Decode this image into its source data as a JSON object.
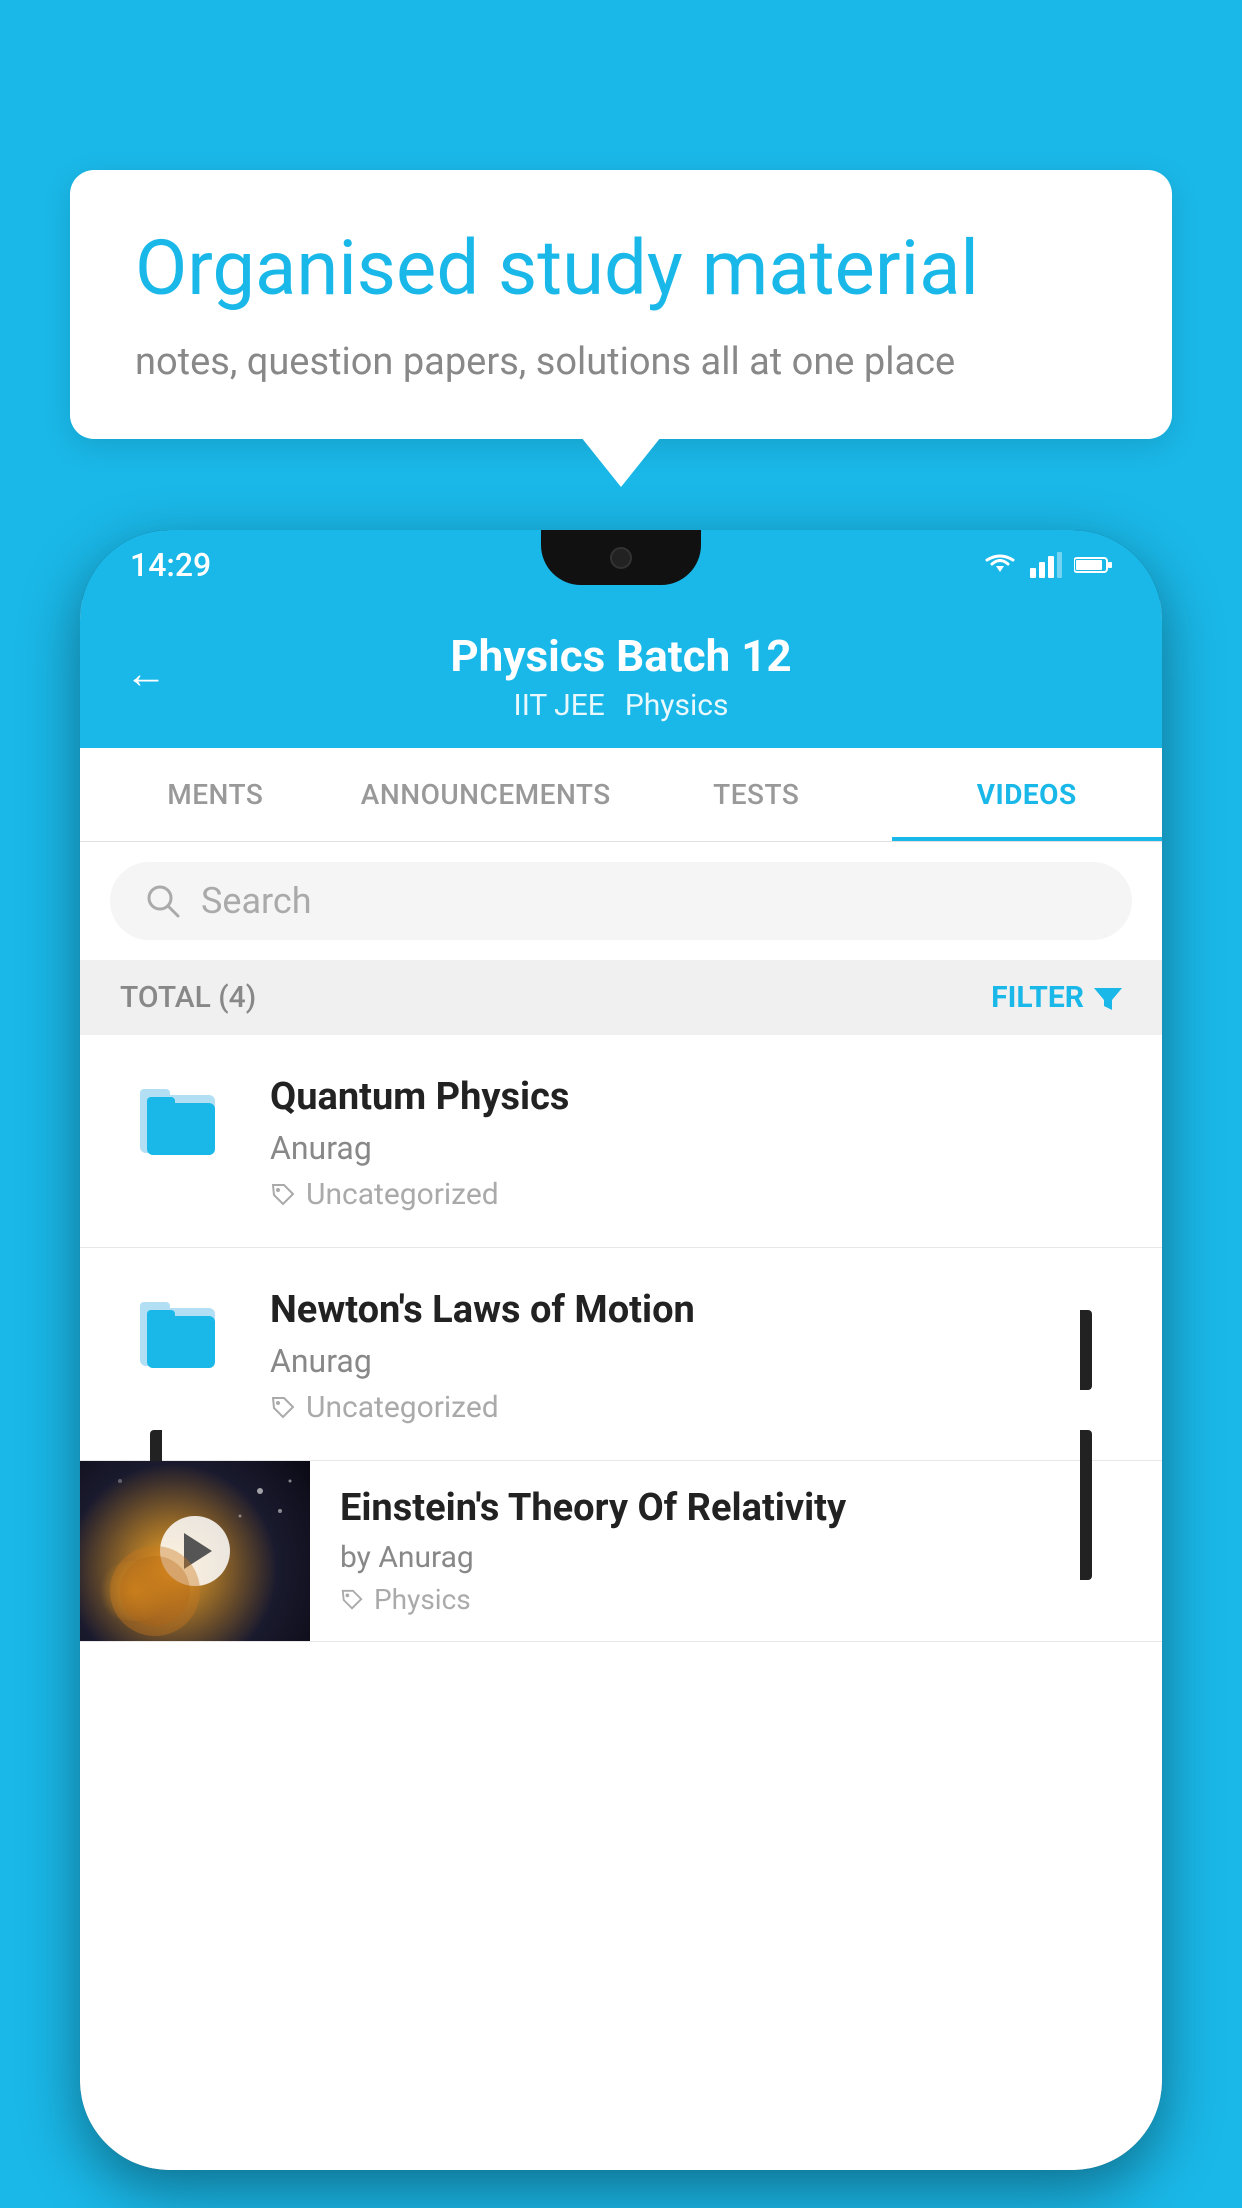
{
  "background_color": "#1ab8e8",
  "bubble": {
    "title": "Organised study material",
    "subtitle": "notes, question papers, solutions all at one place"
  },
  "phone": {
    "status_bar": {
      "time": "14:29",
      "icons": [
        "wifi",
        "signal",
        "battery"
      ]
    },
    "header": {
      "back_label": "←",
      "title": "Physics Batch 12",
      "tags": [
        "IIT JEE",
        "Physics"
      ]
    },
    "tabs": [
      {
        "label": "MENTS",
        "active": false
      },
      {
        "label": "ANNOUNCEMENTS",
        "active": false
      },
      {
        "label": "TESTS",
        "active": false
      },
      {
        "label": "VIDEOS",
        "active": true
      }
    ],
    "search": {
      "placeholder": "Search"
    },
    "filter_bar": {
      "total_label": "TOTAL (4)",
      "filter_label": "FILTER"
    },
    "videos": [
      {
        "id": 1,
        "title": "Quantum Physics",
        "author": "Anurag",
        "tag": "Uncategorized",
        "type": "folder"
      },
      {
        "id": 2,
        "title": "Newton's Laws of Motion",
        "author": "Anurag",
        "tag": "Uncategorized",
        "type": "folder"
      },
      {
        "id": 3,
        "title": "Einstein's Theory Of Relativity",
        "author": "by Anurag",
        "tag": "Physics",
        "type": "video"
      }
    ]
  }
}
